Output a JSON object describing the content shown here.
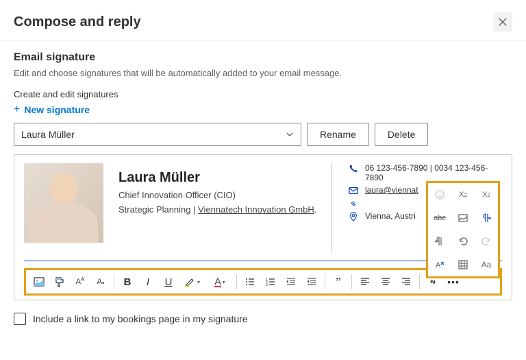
{
  "header": {
    "title": "Compose and reply"
  },
  "section": {
    "title": "Email signature",
    "subtext": "Edit and choose signatures that will be automatically added to your email message.",
    "create_label": "Create and edit signatures",
    "new_signature": "New signature"
  },
  "controls": {
    "selected_signature": "Laura Müller",
    "rename": "Rename",
    "delete": "Delete"
  },
  "signature": {
    "name": "Laura Müller",
    "role": "Chief Innovation Officer (CIO)",
    "org_prefix": "Strategic Planning | ",
    "org_link": "Viennatech Innovation GmbH",
    "org_suffix": ".",
    "contacts": {
      "phone": "06 123-456-7890 | 0034 123-456-7890",
      "email": "laura@viennat",
      "web": "",
      "location": "Vienna, Austri"
    }
  },
  "footer": {
    "include_bookings": "Include a link to my bookings page in my signature"
  },
  "popup": {
    "aa_label": "Aa"
  }
}
